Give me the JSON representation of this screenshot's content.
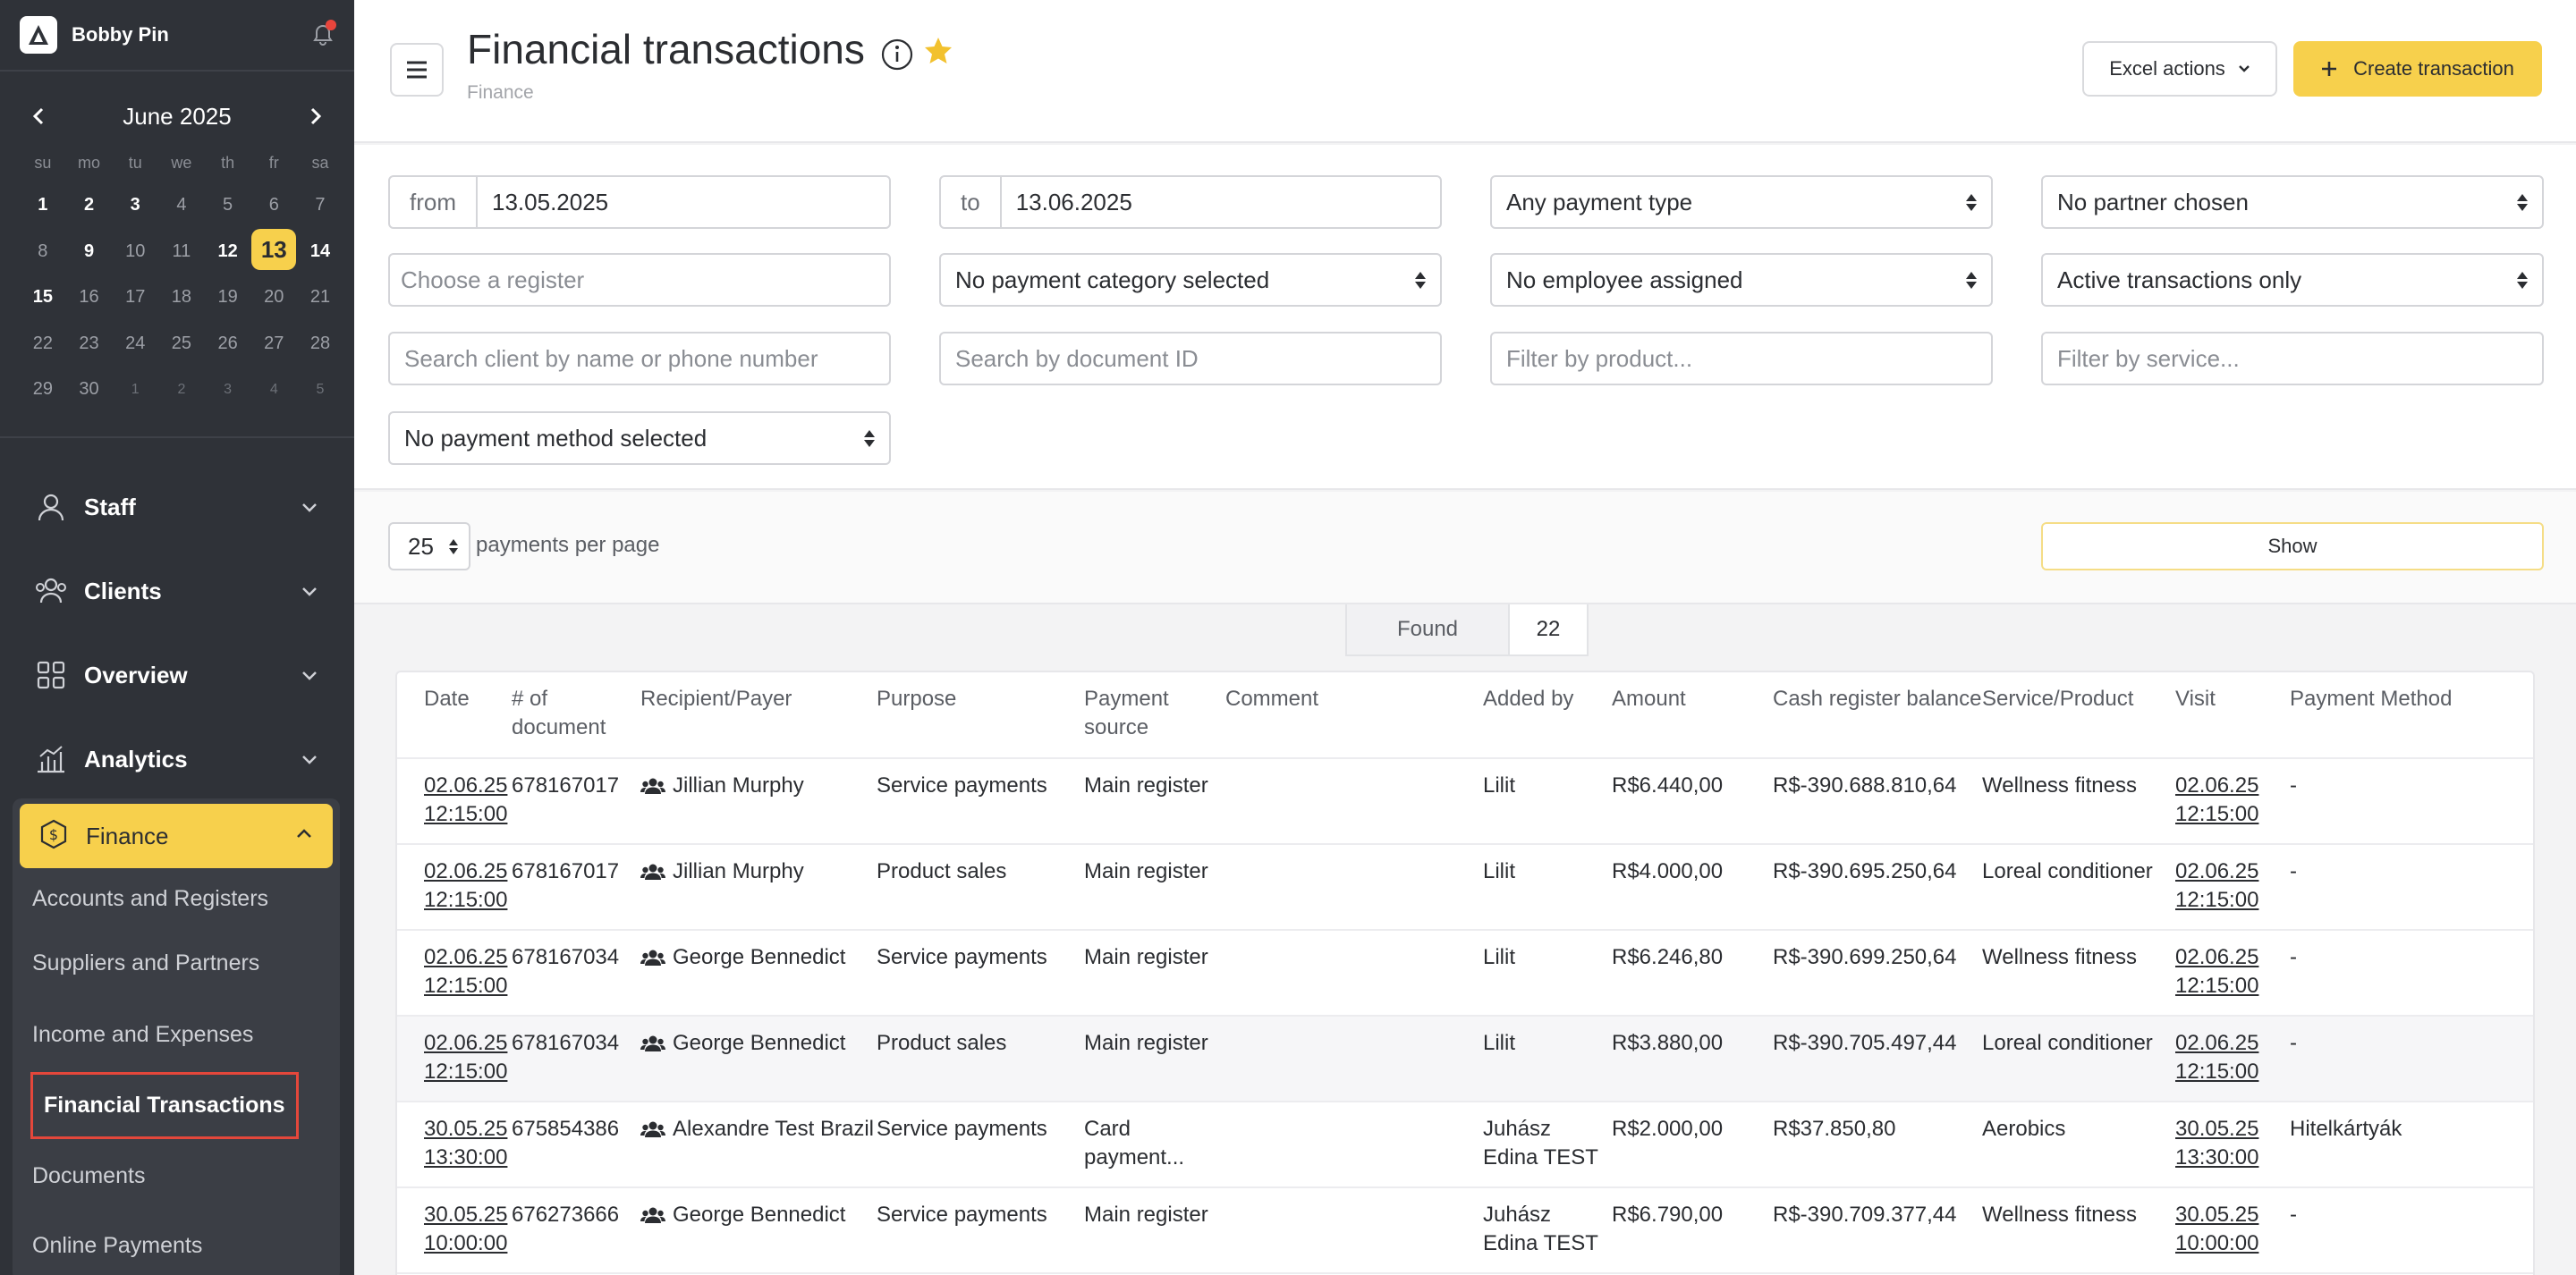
{
  "user": {
    "name": "Bobby Pin"
  },
  "calendar": {
    "month": "June 2025",
    "weekdays": [
      "su",
      "mo",
      "tu",
      "we",
      "th",
      "fr",
      "sa"
    ],
    "weeks": [
      [
        "1",
        "2",
        "3",
        "4",
        "5",
        "6",
        "7"
      ],
      [
        "8",
        "9",
        "10",
        "11",
        "12",
        "13",
        "14"
      ],
      [
        "15",
        "16",
        "17",
        "18",
        "19",
        "20",
        "21"
      ],
      [
        "22",
        "23",
        "24",
        "25",
        "26",
        "27",
        "28"
      ],
      [
        "29",
        "30",
        "1",
        "2",
        "3",
        "4",
        "5"
      ]
    ],
    "selected": "13"
  },
  "nav": {
    "staff": "Staff",
    "clients": "Clients",
    "overview": "Overview",
    "analytics": "Analytics",
    "finance": "Finance",
    "finance_items": {
      "accounts": "Accounts and Registers",
      "suppliers": "Suppliers and Partners",
      "income": "Income and Expenses",
      "transactions": "Financial Transactions",
      "documents": "Documents",
      "online": "Online Payments"
    }
  },
  "header": {
    "title": "Financial transactions",
    "breadcrumb": "Finance",
    "excel_label": "Excel actions",
    "create_label": "Create transaction"
  },
  "filters": {
    "from_label": "from",
    "from_value": "13.05.2025",
    "to_label": "to",
    "to_value": "13.06.2025",
    "payment_type": "Any payment type",
    "partner": "No partner chosen",
    "register_placeholder": "Choose a register",
    "payment_category": "No payment category selected",
    "employee": "No employee assigned",
    "status": "Active transactions only",
    "client_placeholder": "Search client by name or phone number",
    "document_placeholder": "Search by document ID",
    "product_placeholder": "Filter by product...",
    "service_placeholder": "Filter by service...",
    "payment_method": "No payment method selected"
  },
  "pager": {
    "per_page": "25",
    "per_page_label": "payments per page",
    "show_label": "Show",
    "found_label": "Found",
    "found_count": "22"
  },
  "table": {
    "columns": {
      "date": "Date",
      "doc": "# of document",
      "recipient": "Recipient/Payer",
      "purpose": "Purpose",
      "source": "Payment source",
      "comment": "Comment",
      "added": "Added by",
      "amount": "Amount",
      "balance": "Cash register balance",
      "service": "Service/Product",
      "visit": "Visit",
      "method": "Payment Method"
    },
    "rows": [
      {
        "date": "02.06.25 12:15:00",
        "doc": "678167017",
        "recipient": "Jillian Murphy",
        "purpose": "Service payments",
        "source": "Main register",
        "comment": "",
        "added": "Lilit",
        "amount": "R$6.440,00",
        "balance": "R$-390.688.810,64",
        "service": "Wellness fitness",
        "visit": "02.06.25 12:15:00",
        "method": "-"
      },
      {
        "date": "02.06.25 12:15:00",
        "doc": "678167017",
        "recipient": "Jillian Murphy",
        "purpose": "Product sales",
        "source": "Main register",
        "comment": "",
        "added": "Lilit",
        "amount": "R$4.000,00",
        "balance": "R$-390.695.250,64",
        "service": "Loreal conditioner",
        "visit": "02.06.25 12:15:00",
        "method": "-"
      },
      {
        "date": "02.06.25 12:15:00",
        "doc": "678167034",
        "recipient": "George Bennedict",
        "purpose": "Service payments",
        "source": "Main register",
        "comment": "",
        "added": "Lilit",
        "amount": "R$6.246,80",
        "balance": "R$-390.699.250,64",
        "service": "Wellness fitness",
        "visit": "02.06.25 12:15:00",
        "method": "-"
      },
      {
        "date": "02.06.25 12:15:00",
        "doc": "678167034",
        "recipient": "George Bennedict",
        "purpose": "Product sales",
        "source": "Main register",
        "comment": "",
        "added": "Lilit",
        "amount": "R$3.880,00",
        "balance": "R$-390.705.497,44",
        "service": "Loreal conditioner",
        "visit": "02.06.25 12:15:00",
        "method": "-"
      },
      {
        "date": "30.05.25 13:30:00",
        "doc": "675854386",
        "recipient": "Alexandre Test Brazil",
        "purpose": "Service payments",
        "source": "Card payment...",
        "comment": "",
        "added": "Juhász Edina TEST",
        "amount": "R$2.000,00",
        "balance": "R$37.850,80",
        "service": "Aerobics",
        "visit": "30.05.25 13:30:00",
        "method": "Hitelkártyák"
      },
      {
        "date": "30.05.25 10:00:00",
        "doc": "676273666",
        "recipient": "George Bennedict",
        "purpose": "Service payments",
        "source": "Main register",
        "comment": "",
        "added": "Juhász Edina TEST",
        "amount": "R$6.790,00",
        "balance": "R$-390.709.377,44",
        "service": "Wellness fitness",
        "visit": "30.05.25 10:00:00",
        "method": "-"
      }
    ]
  },
  "colors": {
    "accent": "#f7d04c",
    "sidebar": "#2f3238",
    "highlight_border": "#e4473b"
  }
}
